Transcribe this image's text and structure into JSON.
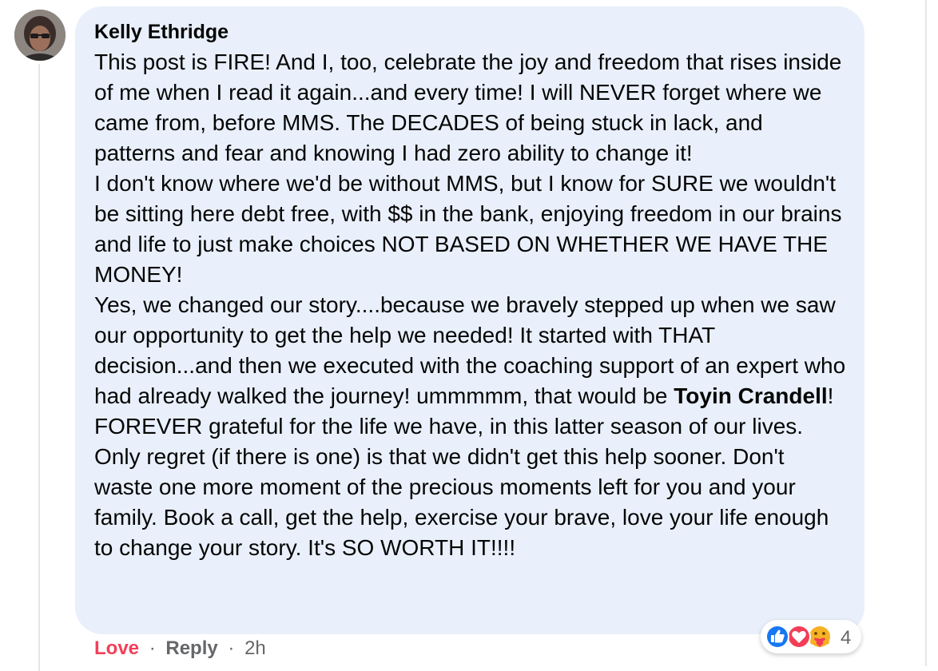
{
  "comment": {
    "author": "Kelly Ethridge",
    "paragraphs": [
      "This post is FIRE! And I, too, celebrate the joy and freedom that rises inside of me when I read it again...and every time! I will NEVER forget where we came from, before MMS. The DECADES of being stuck in lack, and patterns and fear and knowing I had zero ability to change it!",
      "I don't know where we'd be without MMS, but I know for SURE we wouldn't be sitting here debt free, with $$ in the bank, enjoying freedom in our brains and life to just make choices NOT BASED ON WHETHER WE HAVE THE MONEY!"
    ],
    "para3_before_mention": "Yes, we changed our story....because we bravely stepped up when we saw our opportunity to get the help we needed! It started with THAT decision...and then we executed with the coaching support of an expert who had already walked the journey! ummmmm, that would be ",
    "mention": "Toyin Crandell",
    "para3_after_mention": "! FOREVER grateful for the life we have, in this latter season of our lives. Only regret (if there is one) is that we didn't get this help sooner. Don't waste one more moment of the precious moments left for you and your family. Book a call, get the help, exercise your brave, love your life enough to change your story. It's SO WORTH IT!!!!"
  },
  "reactions": {
    "icons": [
      "like-icon",
      "love-icon",
      "care-icon"
    ],
    "count": "4"
  },
  "actions": {
    "love_label": "Love",
    "separator": "·",
    "reply_label": "Reply",
    "timestamp": "2h"
  },
  "colors": {
    "bubble_bg": "#e9f0fb",
    "love_red": "#f33e58",
    "like_blue": "#1877f2",
    "meta_gray": "#65676b"
  }
}
